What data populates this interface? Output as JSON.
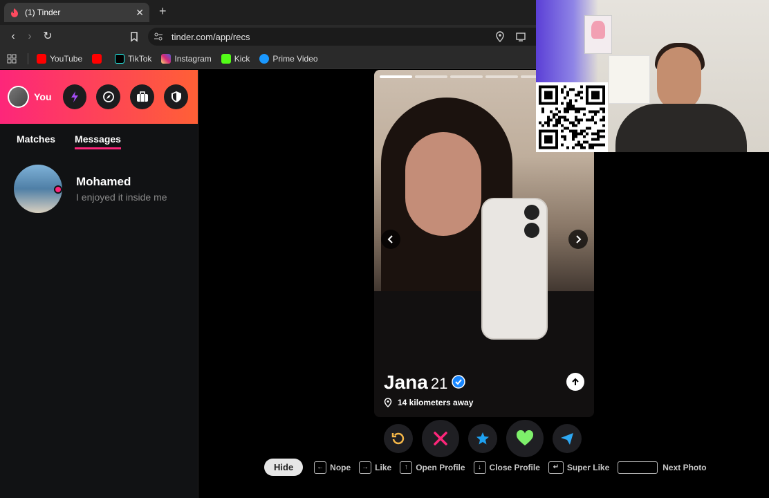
{
  "browser": {
    "tab_title": "(1) Tinder",
    "url": "tinder.com/app/recs",
    "bookmarks": [
      "YouTube",
      "",
      "TikTok",
      "Instagram",
      "Kick",
      "Prime Video"
    ]
  },
  "sidebar": {
    "profile_label": "You",
    "tabs": [
      "Matches",
      "Messages"
    ],
    "active_tab": "Messages",
    "messages": [
      {
        "name": "Mohamed",
        "preview": "I enjoyed it inside me"
      }
    ]
  },
  "card": {
    "name": "Jana",
    "age": "21",
    "distance": "14 kilometers away",
    "photo_count": 6,
    "current_photo": 1
  },
  "actions": [
    "rewind",
    "nope",
    "super-like",
    "like",
    "boost"
  ],
  "hints": {
    "hide": "Hide",
    "items": [
      "Nope",
      "Like",
      "Open Profile",
      "Close Profile",
      "Super Like",
      "Next Photo"
    ]
  },
  "colors": {
    "brand_gradient_start": "#fd267a",
    "brand_gradient_end": "#ff6036",
    "verified": "#1786ff"
  }
}
